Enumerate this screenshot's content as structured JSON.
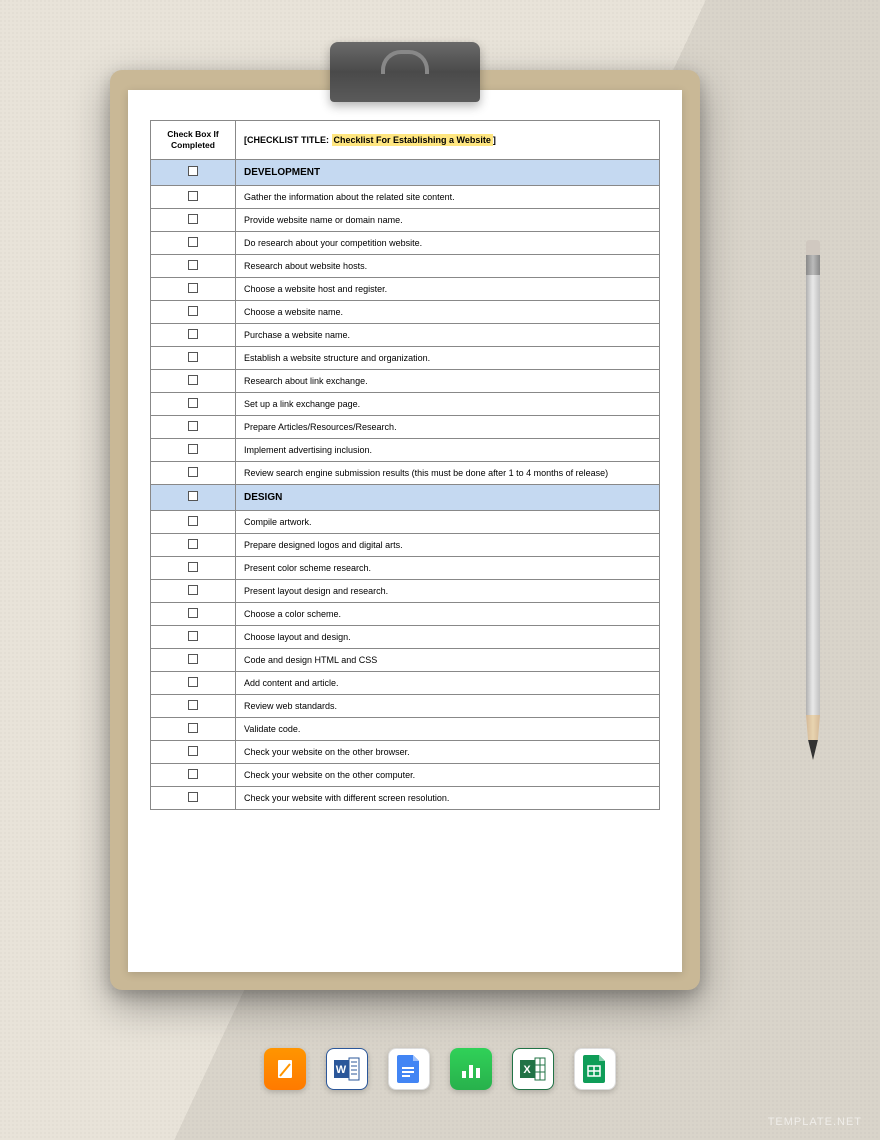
{
  "header": {
    "check_label": "Check Box If Completed",
    "title_prefix": "[CHECKLIST TITLE: ",
    "title_highlight": "Checklist For Establishing a Website",
    "title_suffix": "]"
  },
  "sections": [
    {
      "name": "DEVELOPMENT",
      "items": [
        "Gather the information about the related site content.",
        "Provide website name or domain name.",
        "Do research about your competition website.",
        "Research about website hosts.",
        "Choose a website host and register.",
        "Choose a website name.",
        "Purchase a website name.",
        "Establish a website structure and organization.",
        "Research about link exchange.",
        "Set up a link exchange page.",
        "Prepare Articles/Resources/Research.",
        "Implement advertising inclusion.",
        "Review search engine submission results (this must be done after 1 to 4 months of release)"
      ]
    },
    {
      "name": "DESIGN",
      "items": [
        "Compile artwork.",
        "Prepare designed logos and digital arts.",
        "Present color scheme research.",
        "Present layout design and research.",
        "Choose a color scheme.",
        "Choose layout and design.",
        "Code and design HTML and CSS",
        "Add content and article.",
        "Review web standards.",
        "Validate code.",
        "Check your website on the other browser.",
        "Check your website on the other computer.",
        "Check your website with different screen resolution."
      ]
    }
  ],
  "icons": [
    "pages",
    "word",
    "gdocs",
    "numbers",
    "excel",
    "gsheets"
  ],
  "watermark": "TEMPLATE.NET"
}
